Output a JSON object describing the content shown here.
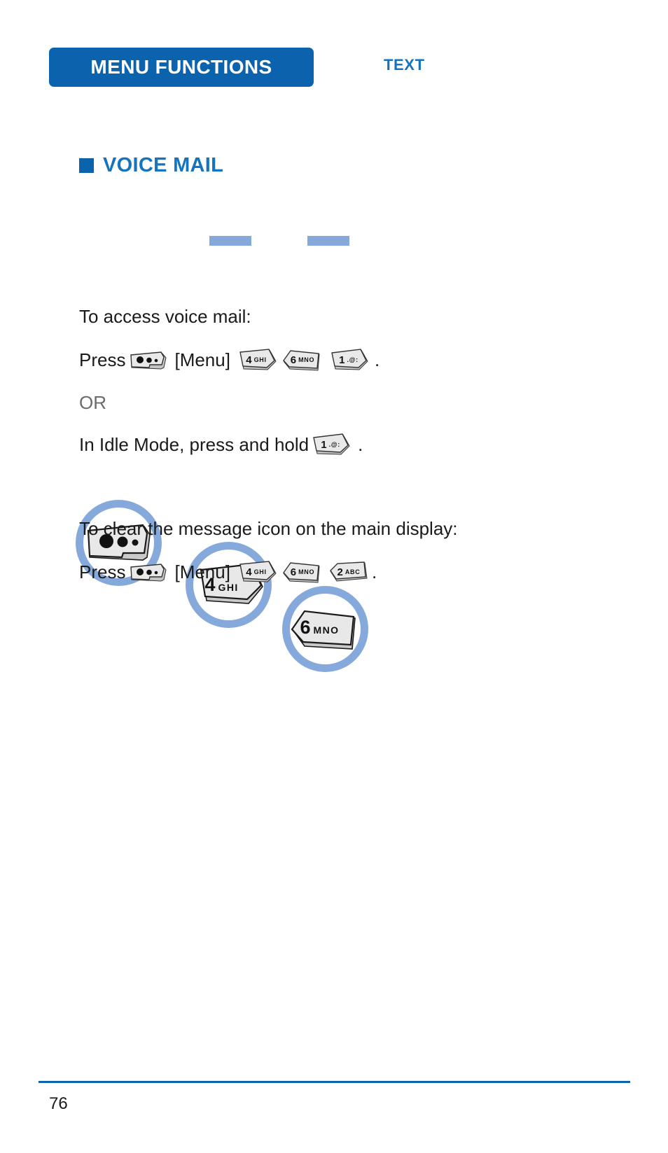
{
  "header": {
    "tab_label": "MENU FUNCTIONS",
    "section_label": "TEXT",
    "tab_color": "#0b63ae",
    "section_color": "#1574bd"
  },
  "section": {
    "heading": "VOICE MAIL",
    "heading_color": "#1574bd",
    "bullet_color": "#0b63ae"
  },
  "flow": {
    "connector_color": "#86a9dc",
    "circle_border_color": "#86a9dc",
    "steps": [
      {
        "icon": "menu-key-icon",
        "number": "",
        "letters": ""
      },
      {
        "icon": "keypad-key-icon",
        "number": "4",
        "letters": "GHI"
      },
      {
        "icon": "keypad-key-icon",
        "number": "6",
        "letters": "MNO"
      }
    ]
  },
  "body": {
    "line1": "To access voice mail:",
    "line2_prefix": "Press",
    "line2_menu_label": "[Menu]",
    "line2_suffix": ".",
    "line2_keys": [
      {
        "number": "4",
        "letters": "GHI"
      },
      {
        "number": "6",
        "letters": "MNO"
      },
      {
        "number": "1",
        "letters": ".@:"
      }
    ],
    "line3": "OR",
    "line4_prefix": "In Idle Mode, press and hold",
    "line4_suffix": ".",
    "line4_keys": [
      {
        "number": "1",
        "letters": ".@:"
      }
    ],
    "line5": "To clear the message icon on the main display:",
    "line6_prefix": "Press",
    "line6_menu_label": "[Menu]",
    "line6_suffix": ".",
    "line6_keys": [
      {
        "number": "4",
        "letters": "GHI"
      },
      {
        "number": "6",
        "letters": "MNO"
      },
      {
        "number": "2",
        "letters": "ABC"
      }
    ]
  },
  "footer": {
    "page_number": "76",
    "rule_color": "#0b63ae"
  }
}
